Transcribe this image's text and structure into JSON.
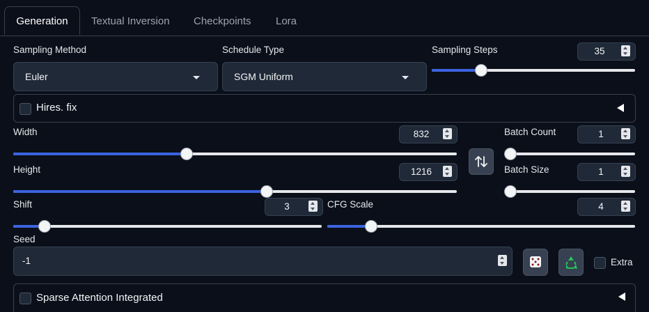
{
  "tabs": [
    {
      "label": "Generation",
      "active": true
    },
    {
      "label": "Textual Inversion",
      "active": false
    },
    {
      "label": "Checkpoints",
      "active": false
    },
    {
      "label": "Lora",
      "active": false
    }
  ],
  "sampling_method": {
    "label": "Sampling Method",
    "value": "Euler"
  },
  "schedule_type": {
    "label": "Schedule Type",
    "value": "SGM Uniform"
  },
  "sampling_steps": {
    "label": "Sampling Steps",
    "value": "35",
    "fraction": 0.24
  },
  "hires_fix": {
    "label": "Hires. fix",
    "checked": false
  },
  "width": {
    "label": "Width",
    "value": "832",
    "fraction": 0.39
  },
  "height": {
    "label": "Height",
    "value": "1216",
    "fraction": 0.57
  },
  "swap_icon": "swap-vertical-arrows",
  "batch_count": {
    "label": "Batch Count",
    "value": "1",
    "fraction": 0.0
  },
  "batch_size": {
    "label": "Batch Size",
    "value": "1",
    "fraction": 0.0
  },
  "shift": {
    "label": "Shift",
    "value": "3",
    "fraction": 0.1
  },
  "cfg_scale": {
    "label": "CFG Scale",
    "value": "4",
    "fraction": 0.14
  },
  "seed": {
    "label": "Seed",
    "value": "-1"
  },
  "random_seed_icon": "dice",
  "reuse_seed_icon": "recycle",
  "extra": {
    "label": "Extra",
    "checked": false
  },
  "sparse_attention": {
    "label": "Sparse Attention Integrated",
    "checked": false
  },
  "colors": {
    "accent": "#3b63e0",
    "background": "#0b0f19",
    "panel": "#1f2937",
    "border": "#374151"
  }
}
